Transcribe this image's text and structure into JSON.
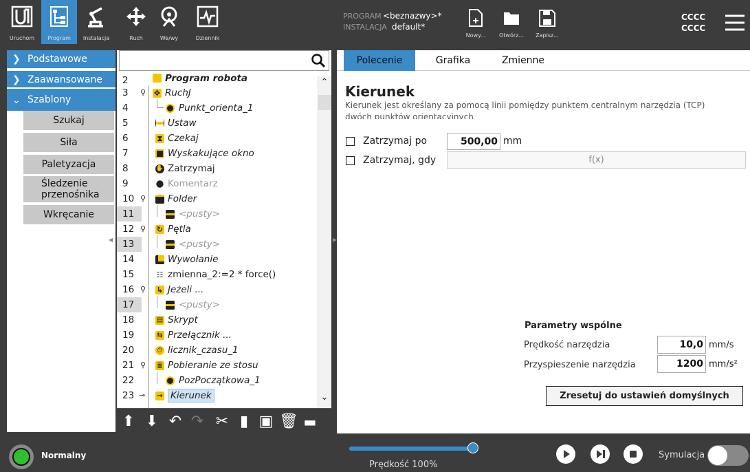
{
  "header": {
    "nav": [
      {
        "label": "Uruchom",
        "icon": "ur-logo-icon"
      },
      {
        "label": "Program",
        "icon": "program-tree-icon"
      },
      {
        "label": "Instalacja",
        "icon": "robot-arm-icon"
      },
      {
        "label": "Ruch",
        "icon": "move-arrows-icon"
      },
      {
        "label": "We/wy",
        "icon": "io-icon"
      },
      {
        "label": "Dziennik",
        "icon": "log-chart-icon"
      }
    ],
    "program_label": "PROGRAM",
    "program_name": "<beznazwy>*",
    "install_label": "INSTALACJA",
    "install_name": "default*",
    "file_buttons": [
      {
        "label": "Nowy...",
        "icon": "new-file-icon"
      },
      {
        "label": "Otwórz...",
        "icon": "folder-icon"
      },
      {
        "label": "Zapisz...",
        "icon": "save-icon"
      }
    ],
    "user_line1": "CCCC",
    "user_line2": "CCCC"
  },
  "sidebar": {
    "categories": [
      "Podstawowe",
      "Zaawansowane",
      "Szablony"
    ],
    "templates": [
      "Szukaj",
      "Siła",
      "Paletyzacja",
      "Śledzenie przenośnika",
      "Wkręcanie"
    ]
  },
  "tree": {
    "search_placeholder": "",
    "rows": [
      {
        "num": "2",
        "text": "Program robota",
        "icon": "program-icon"
      },
      {
        "num": "3",
        "text": "RuchJ",
        "icon": "move-icon"
      },
      {
        "num": "4",
        "text": "Punkt_orienta_1",
        "icon": "waypoint-icon"
      },
      {
        "num": "5",
        "text": "Ustaw",
        "icon": "set-icon"
      },
      {
        "num": "6",
        "text": "Czekaj",
        "icon": "wait-icon"
      },
      {
        "num": "7",
        "text": "Wyskakujące okno",
        "icon": "popup-icon"
      },
      {
        "num": "8",
        "text": "Zatrzymaj",
        "icon": "halt-icon"
      },
      {
        "num": "9",
        "text": "Komentarz",
        "icon": "comment-icon"
      },
      {
        "num": "10",
        "text": "Folder",
        "icon": "folder-node-icon"
      },
      {
        "num": "11",
        "text": "<pusty>",
        "icon": "empty-icon"
      },
      {
        "num": "12",
        "text": "Pętla",
        "icon": "loop-icon"
      },
      {
        "num": "13",
        "text": "<pusty>",
        "icon": "empty-icon"
      },
      {
        "num": "14",
        "text": "Wywołanie",
        "icon": "call-icon"
      },
      {
        "num": "15",
        "text": "zmienna_2:=2 * force()",
        "icon": "assignment-icon"
      },
      {
        "num": "16",
        "text": "Jeżeli ...",
        "icon": "if-icon"
      },
      {
        "num": "17",
        "text": "<pusty>",
        "icon": "empty-icon"
      },
      {
        "num": "18",
        "text": "Skrypt",
        "icon": "script-icon"
      },
      {
        "num": "19",
        "text": "Przełącznik ...",
        "icon": "switch-icon"
      },
      {
        "num": "20",
        "text": "licznik_czasu_1",
        "icon": "timer-icon"
      },
      {
        "num": "21",
        "text": "Pobieranie ze stosu",
        "icon": "pallet-icon"
      },
      {
        "num": "22",
        "text": "PozPoczątkowa_1",
        "icon": "waypoint-icon"
      },
      {
        "num": "23",
        "text": "Kierunek",
        "icon": "direction-icon"
      }
    ]
  },
  "tabs": [
    "Polecenie",
    "Grafika",
    "Zmienne"
  ],
  "command": {
    "title": "Kierunek",
    "description_line1": "Kierunek jest określany za pomocą linii pomiędzy punktem centralnym narzędzia (TCP)",
    "description_line2": "dwóch punktów orientacyjnych",
    "stop_after_label": "Zatrzymaj po",
    "stop_after_value": "500,00",
    "stop_after_unit": "mm",
    "stop_when_label": "Zatrzymaj, gdy",
    "stop_when_value": "f(x)",
    "params_title": "Parametry wspólne",
    "tool_speed_label": "Prędkość narzędzia",
    "tool_speed_value": "10,0",
    "tool_speed_unit": "mm/s",
    "tool_accel_label": "Przyspieszenie narzędzia",
    "tool_accel_value": "1200",
    "tool_accel_unit": "mm/s²",
    "reset_label": "Zresetuj do ustawień domyślnych"
  },
  "footer": {
    "status": "Normalny",
    "speed_label": "Prędkość 100%",
    "speed_fraction": 1.0,
    "sim_label": "Symulacja"
  },
  "colors": {
    "accent": "#3b8bc8",
    "dark": "#3c3c3c",
    "icon_yellow": "#f6c400",
    "status_green": "#2ec02e"
  }
}
